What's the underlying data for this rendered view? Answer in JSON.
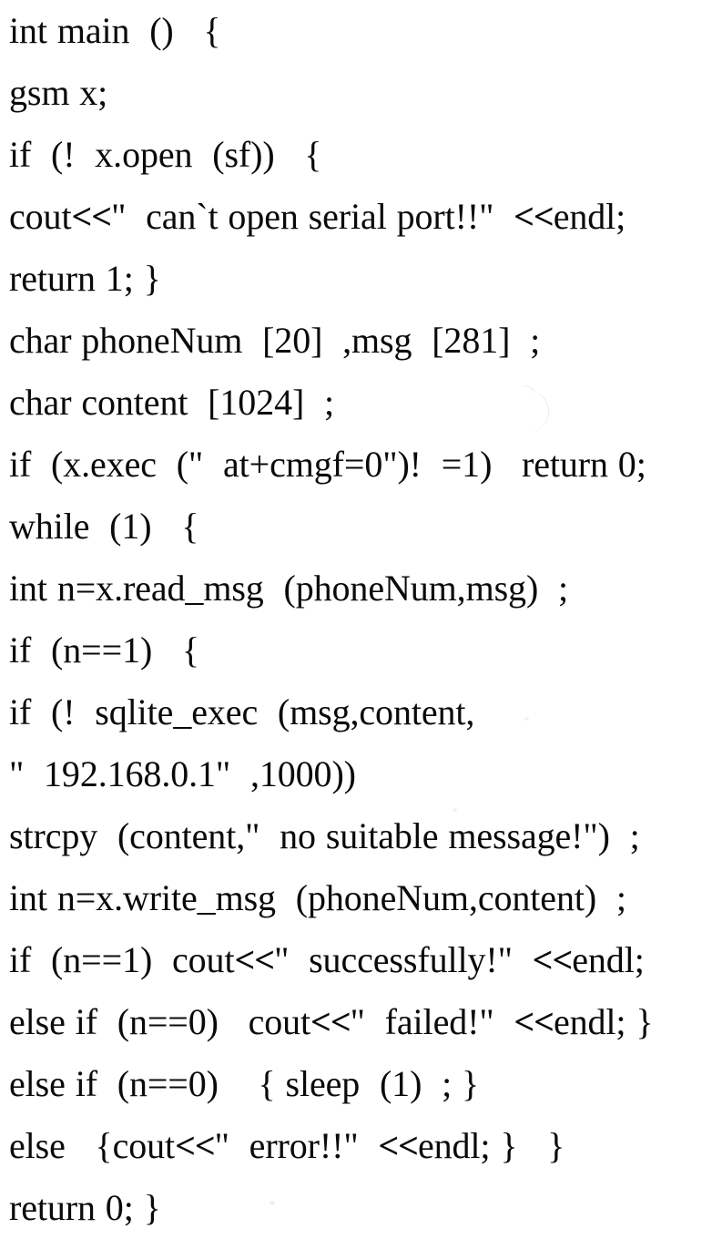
{
  "document": {
    "kind": "scanned-code-listing",
    "language": "C++",
    "background_color": "#ffffff",
    "text_color": "#0a0a0a",
    "line_count": 19
  },
  "code": {
    "lines": [
      {
        "n": 1,
        "text": "int main  ()   {"
      },
      {
        "n": 2,
        "text": "gsm x;"
      },
      {
        "n": 3,
        "text": "if  (!  x.open  (sf))   {"
      },
      {
        "n": 4,
        "text": "cout<<\"  can`t open serial port!!\"  <<endl;"
      },
      {
        "n": 5,
        "text": "return 1; }"
      },
      {
        "n": 6,
        "text": "char phoneNum  [20]  ,msg  [281]  ;"
      },
      {
        "n": 7,
        "text": "char content  [1024]  ;"
      },
      {
        "n": 8,
        "text": "if  (x.exec  (\"  at+cmgf=0\")!  =1)   return 0;"
      },
      {
        "n": 9,
        "text": "while  (1)   {"
      },
      {
        "n": 10,
        "text": "int n=x.read_msg  (phoneNum,msg)  ;"
      },
      {
        "n": 11,
        "text": "if  (n==1)   {"
      },
      {
        "n": 12,
        "text": "if  (!  sqlite_exec  (msg,content,"
      },
      {
        "n": 13,
        "text": "\"  192.168.0.1\"  ,1000))"
      },
      {
        "n": 14,
        "text": "strcpy  (content,\"  no suitable message!\")  ;"
      },
      {
        "n": 15,
        "text": "int n=x.write_msg  (phoneNum,content)  ;"
      },
      {
        "n": 16,
        "text": "if  (n==1)  cout<<\"  successfully!\"  <<endl;"
      },
      {
        "n": 17,
        "text": "else if  (n==0)   cout<<\"  failed!\"  <<endl; }"
      },
      {
        "n": 18,
        "text": "else if  (n==0)    { sleep  (1)  ; }"
      },
      {
        "n": 19,
        "text": "else   {cout<<\"  error!!\"  <<endl; }   }"
      },
      {
        "n": 20,
        "text": "return 0; }"
      }
    ]
  }
}
